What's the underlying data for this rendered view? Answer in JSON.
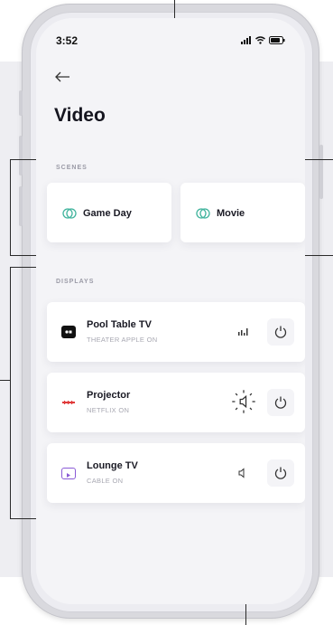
{
  "status": {
    "time": "3:52"
  },
  "screen": {
    "title": "Video"
  },
  "scenes": {
    "label": "SCENES",
    "items": [
      {
        "label": "Game Day",
        "icon": "scene-icon"
      },
      {
        "label": "Movie",
        "icon": "scene-icon"
      }
    ]
  },
  "displays": {
    "label": "DISPLAYS",
    "items": [
      {
        "name": "Pool Table TV",
        "source": "THEATER APPLE ON",
        "thumb": "apple-tv-icon",
        "status_icon": "volume-bars-icon"
      },
      {
        "name": "Projector",
        "source": "NETFLIX ON",
        "thumb": "netflix-icon",
        "status_icon": "volume-ringing-icon"
      },
      {
        "name": "Lounge TV",
        "source": "CABLE ON",
        "thumb": "cable-tv-icon",
        "status_icon": "volume-muted-icon"
      }
    ]
  },
  "colors": {
    "accent": "#3fb39c",
    "brand_red": "#e03a3a",
    "cable_purple": "#8a5ad6"
  },
  "annotations": {
    "left_bracket_dots": "...",
    "lower_dots": "..."
  }
}
